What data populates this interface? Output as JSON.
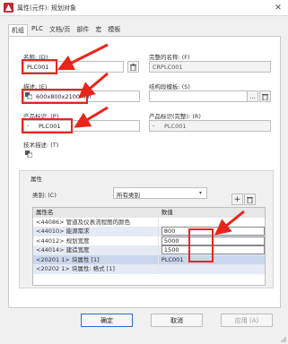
{
  "window": {
    "title": "属性(元件): 规划对象",
    "close_glyph": "✕"
  },
  "tabs": [
    {
      "label": "机组",
      "active": true
    },
    {
      "label": "PLC"
    },
    {
      "label": "文档/页"
    },
    {
      "label": "部件"
    },
    {
      "label": "宏"
    },
    {
      "label": "模板"
    }
  ],
  "fields": {
    "name_label": "名称: (D)",
    "name_value": "PLC001",
    "full_name_label": "完整的名称: (F)",
    "full_name_value": "CRPLC001",
    "desc_label": "描述: (E)",
    "desc_value": "600x800x2100mm",
    "structure_template_label": "结构段模板: (S)",
    "structure_template_value": "",
    "product_id_label": "产品标识: (P)",
    "product_id_value": "PLC001",
    "product_id_prefix": "-",
    "product_id_full_label": "产品标识(完整): (R)",
    "product_id_full_value": "PLC001",
    "product_id_full_prefix": "-",
    "tech_desc_label": "技术描述: (T)",
    "tech_desc_value": "",
    "browse_glyph": "...",
    "delete_glyph": "🗑"
  },
  "properties": {
    "group_label": "属性",
    "category_label": "类别: (C)",
    "category_value": "所有类别",
    "add_glyph": "+",
    "columns": [
      "属性名",
      "数值"
    ],
    "rows": [
      {
        "name": "<44086> 管道及仪表流程图的颜色",
        "value": ""
      },
      {
        "name": "<44010> 能源需求",
        "value": "800"
      },
      {
        "name": "<44012> 规划宽度",
        "value": "5000"
      },
      {
        "name": "<44014> 建造宽度",
        "value": "1500"
      },
      {
        "name": "<20201 1> 块属性 [1]",
        "value": "PLC001"
      },
      {
        "name": "<20202 1> 块属性: 格式 [1]",
        "value": ""
      }
    ]
  },
  "buttons": {
    "ok": "确定",
    "cancel": "取消",
    "apply": "应用 (A)"
  },
  "colors": {
    "highlight": "#e8261b",
    "accent": "#2d6ad6"
  }
}
